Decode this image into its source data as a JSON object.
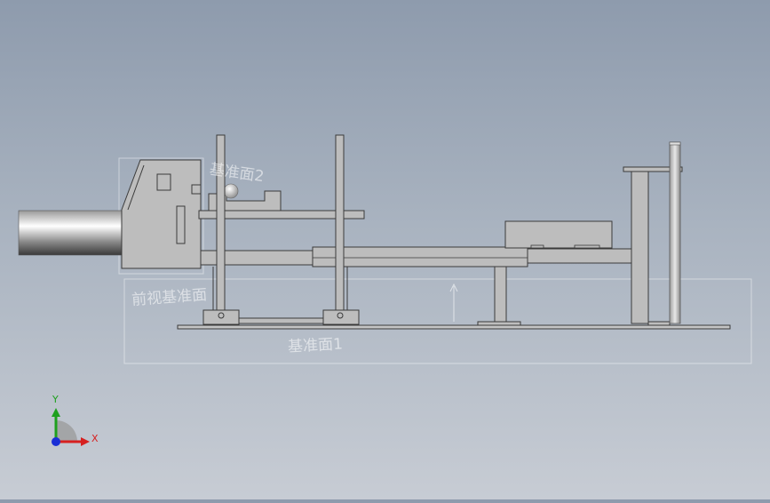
{
  "viewport": {
    "background_top": "#8e9bad",
    "background_bottom": "#c7ccd4"
  },
  "planes": {
    "plane_2": "基准面2",
    "front_plane": "前视基准面",
    "base_plane": "基准面1"
  },
  "triad": {
    "x_label": "X",
    "y_label": "Y",
    "x_color": "#d62020",
    "y_color": "#1ea01e",
    "z_color": "#1a2fd6"
  },
  "model": {
    "part_fill": "#bdbdbd",
    "part_edge": "#3a3a3a",
    "cylinder_fill": "#cfcfcf"
  }
}
